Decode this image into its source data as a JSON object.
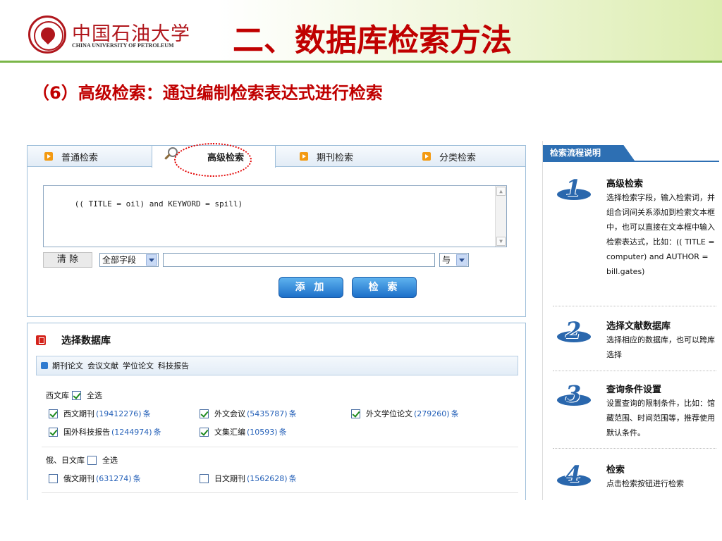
{
  "slide": {
    "logo_cn": "中国石油大学",
    "logo_en": "CHINA UNIVERSITY OF PETROLEUM",
    "title": "二、数据库检索方法",
    "subtitle": "（6）高级检索：通过编制检索表达式进行检索"
  },
  "tabs": [
    {
      "label": "普通检索"
    },
    {
      "label": "高级检索"
    },
    {
      "label": "期刊检索"
    },
    {
      "label": "分类检索"
    }
  ],
  "search": {
    "query": "(( TITLE = oil) and KEYWORD = spill)",
    "clear_label": "清 除",
    "field_select": "全部字段",
    "logic_select": "与",
    "add_label": "添 加",
    "search_label": "检 索"
  },
  "databases": {
    "title": "选择数据库",
    "categories": [
      "期刊论文",
      "会议文献",
      "学位论文",
      "科技报告"
    ],
    "western": {
      "label": "西文库",
      "select_all": "全选",
      "items": [
        {
          "name": "西文期刊",
          "count": "(19412276)",
          "unit": "条"
        },
        {
          "name": "外文会议",
          "count": "(5435787)",
          "unit": "条"
        },
        {
          "name": "外文学位论文",
          "count": "(279260)",
          "unit": "条"
        },
        {
          "name": "国外科技报告",
          "count": "(1244974)",
          "unit": "条"
        },
        {
          "name": "文集汇编",
          "count": "(10593)",
          "unit": "条"
        }
      ]
    },
    "ru_jp": {
      "label": "俄、日文库",
      "select_all": "全选",
      "items": [
        {
          "name": "俄文期刊",
          "count": "(631274)",
          "unit": "条"
        },
        {
          "name": "日文期刊",
          "count": "(1562628)",
          "unit": "条"
        }
      ]
    }
  },
  "help": {
    "header": "检索流程说明",
    "steps": [
      {
        "num": "1",
        "title": "高级检索",
        "text": "选择检索字段，输入检索词，并组合词间关系添加到检索文本框中，也可以直接在文本框中输入检索表达式，比如：(( TITLE = computer) and AUTHOR = bill.gates)"
      },
      {
        "num": "2",
        "title": "选择文献数据库",
        "text": "选择相应的数据库，也可以跨库选择"
      },
      {
        "num": "3",
        "title": "查询条件设置",
        "text": "设置查询的限制条件，比如：馆藏范围、时间范围等，推荐使用默认条件。"
      },
      {
        "num": "4",
        "title": "检索",
        "text": "点击检索按钮进行检索"
      }
    ]
  },
  "colors": {
    "title_red": "#c00000",
    "accent_green": "#7ab648",
    "button_blue": "#1c6fc9",
    "help_blue": "#2d6fb3"
  }
}
